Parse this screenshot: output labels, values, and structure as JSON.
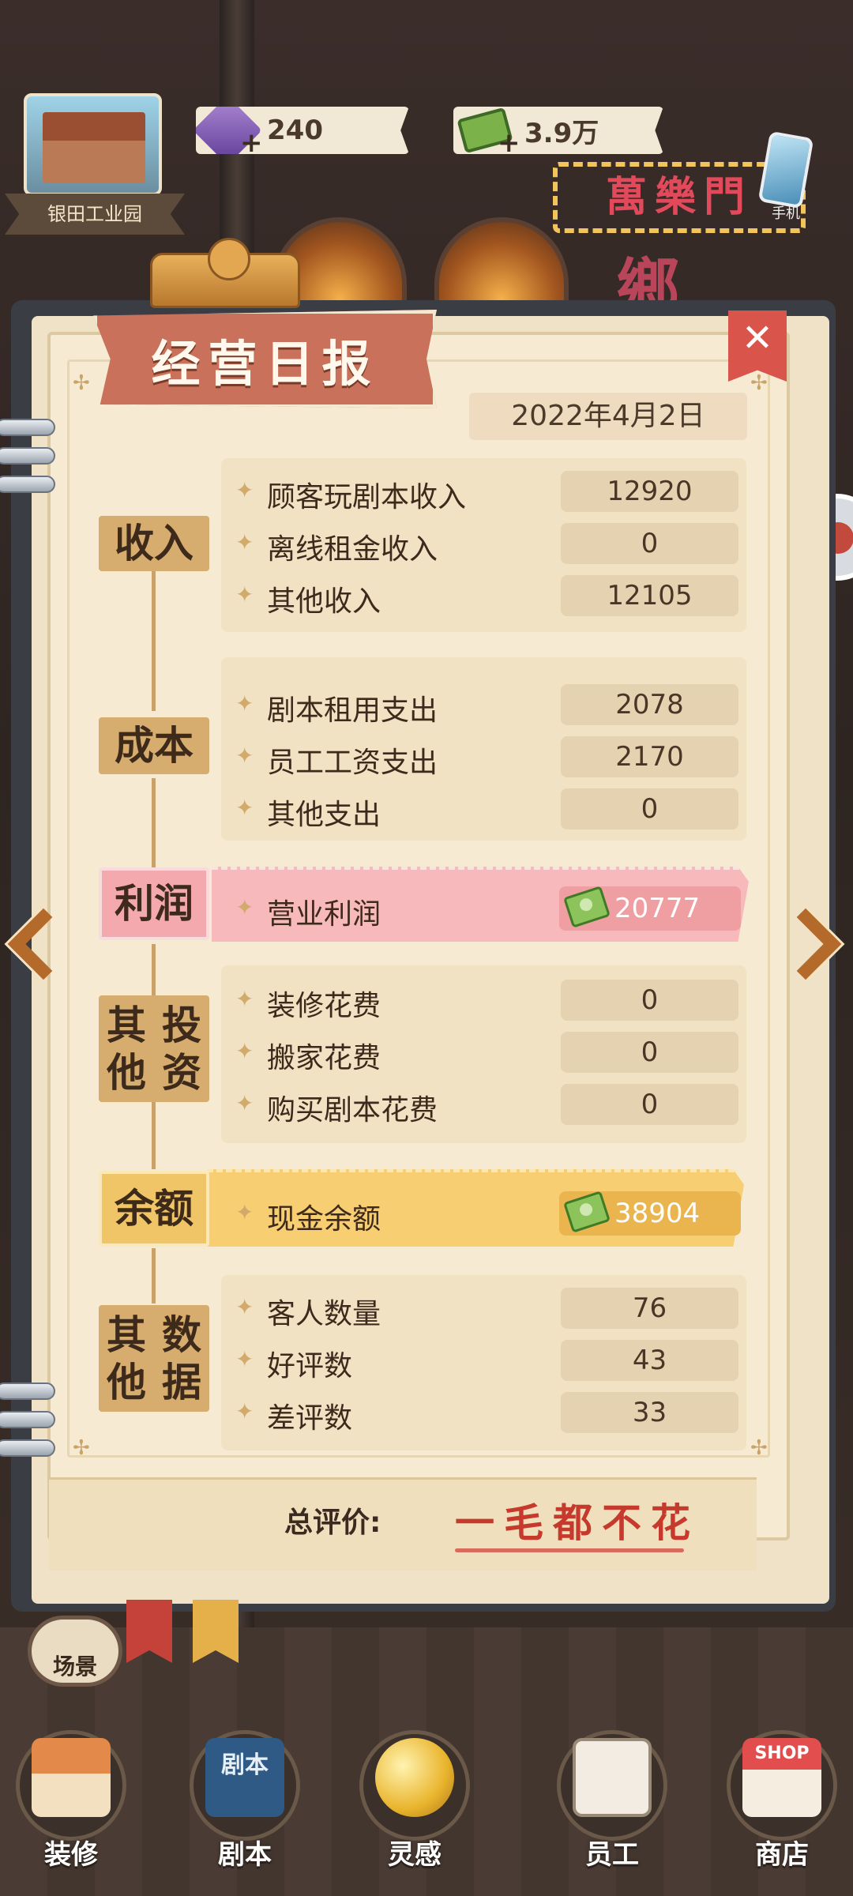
{
  "hud": {
    "building_name": "银田工业园",
    "gems": "240",
    "cash": "3.9万",
    "phone_label": "手机"
  },
  "background": {
    "neon_sign": "萬樂門",
    "neon_sign2": "鄉"
  },
  "report": {
    "title": "经营日报",
    "date": "2022年4月2日",
    "close_label": "✕",
    "sections": {
      "income": {
        "label": "收入",
        "rows": [
          {
            "label": "顾客玩剧本收入",
            "value": "12920"
          },
          {
            "label": "离线租金收入",
            "value": "0"
          },
          {
            "label": "其他收入",
            "value": "12105"
          }
        ]
      },
      "cost": {
        "label": "成本",
        "rows": [
          {
            "label": "剧本租用支出",
            "value": "2078"
          },
          {
            "label": "员工工资支出",
            "value": "2170"
          },
          {
            "label": "其他支出",
            "value": "0"
          }
        ]
      },
      "profit": {
        "label": "利润",
        "row": {
          "label": "营业利润",
          "value": "20777"
        }
      },
      "invest": {
        "label_line1": "其他",
        "label_line2": "投资",
        "rows": [
          {
            "label": "装修花费",
            "value": "0"
          },
          {
            "label": "搬家花费",
            "value": "0"
          },
          {
            "label": "购买剧本花费",
            "value": "0"
          }
        ]
      },
      "balance": {
        "label": "余额",
        "row": {
          "label": "现金余额",
          "value": "38904"
        }
      },
      "other": {
        "label_line1": "其他",
        "label_line2": "数据",
        "rows": [
          {
            "label": "客人数量",
            "value": "76"
          },
          {
            "label": "好评数",
            "value": "43"
          },
          {
            "label": "差评数",
            "value": "33"
          }
        ]
      }
    },
    "overall_label": "总评价:",
    "overall_value": "一毛都不花"
  },
  "scene_button": "场景",
  "bottom_nav": [
    {
      "label": "装修"
    },
    {
      "label": "剧本",
      "icon_text": "剧本"
    },
    {
      "label": "灵感"
    },
    {
      "label": "员工"
    },
    {
      "label": "商店",
      "icon_text": "SHOP"
    }
  ],
  "colors": {
    "accent_red": "#d9554c",
    "profit_pink": "#f7b9bb",
    "balance_yellow": "#f7cf72",
    "category_tan": "#d6ad6e"
  }
}
